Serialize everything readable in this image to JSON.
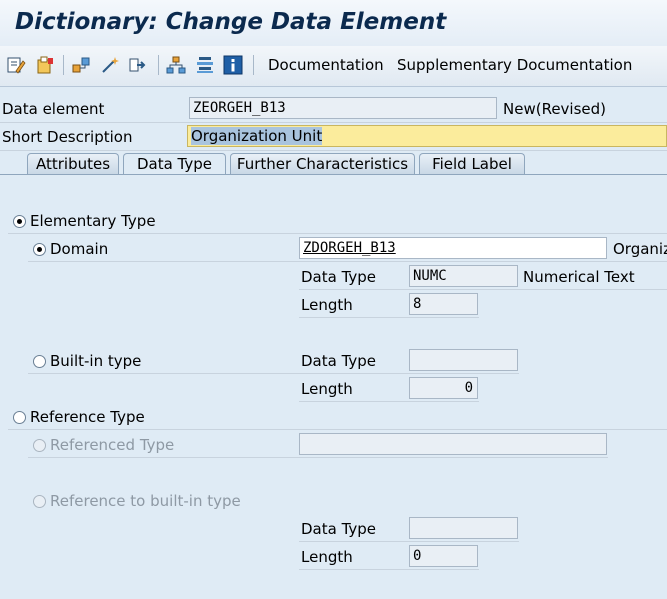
{
  "window": {
    "title": "Dictionary: Change Data Element"
  },
  "toolbar": {
    "icons": [
      "display-change-icon",
      "activate-icon",
      "where-used-icon",
      "check-icon",
      "navigate-icon",
      "hierarchy-icon",
      "stack-icon",
      "info-icon"
    ],
    "documentation_label": "Documentation",
    "supplementary_label": "Supplementary Documentation"
  },
  "header": {
    "data_element_label": "Data element",
    "data_element_value": "ZEORGEH_B13",
    "status": "New(Revised)",
    "short_desc_label": "Short Description",
    "short_desc_value": "Organization Unit"
  },
  "tabs": [
    {
      "label": "Attributes",
      "active": false
    },
    {
      "label": "Data Type",
      "active": true
    },
    {
      "label": "Further Characteristics",
      "active": false
    },
    {
      "label": "Field Label",
      "active": false
    }
  ],
  "elementary": {
    "label": "Elementary Type",
    "selected": true,
    "domain": {
      "label": "Domain",
      "selected": true,
      "value": "ZDORGEH_B13",
      "description": "Organiz",
      "data_type_label": "Data Type",
      "data_type_value": "NUMC",
      "data_type_text": "Numerical Text",
      "length_label": "Length",
      "length_value": "8"
    },
    "builtin": {
      "label": "Built-in type",
      "selected": false,
      "data_type_label": "Data Type",
      "data_type_value": "",
      "length_label": "Length",
      "length_value": "0"
    }
  },
  "reference": {
    "label": "Reference Type",
    "selected": false,
    "referenced_type_label": "Referenced Type",
    "referenced_type_value": "",
    "ref_builtin_label": "Reference to built-in type",
    "data_type_label": "Data Type",
    "data_type_value": "",
    "length_label": "Length",
    "length_value": "0"
  }
}
